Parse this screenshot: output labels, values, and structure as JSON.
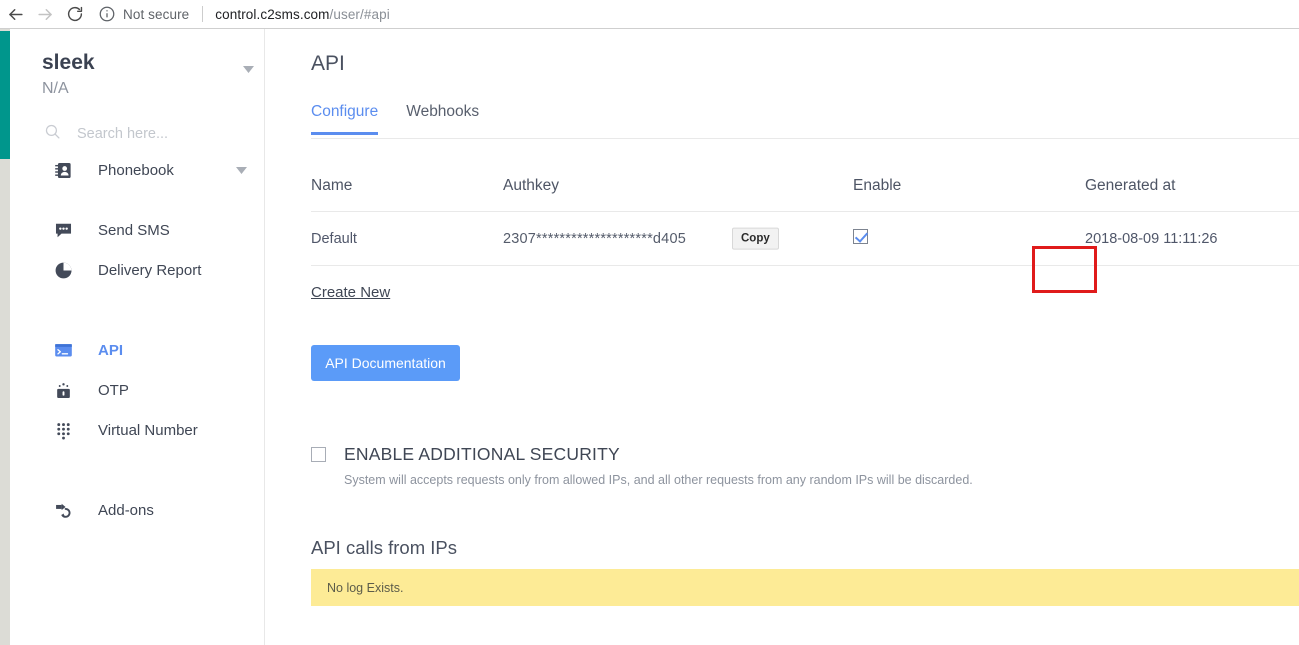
{
  "browser": {
    "back_icon": "back-arrow-icon",
    "forward_icon": "forward-arrow-icon",
    "reload_icon": "reload-icon",
    "security_icon": "info-circle-icon",
    "security_label": "Not secure",
    "url_host": "control.c2sms.com",
    "url_path": "/user/#api"
  },
  "sidebar": {
    "brand": "sleek",
    "brand_sub": "N/A",
    "brand_caret_icon": "chevron-down-icon",
    "search": {
      "placeholder": "Search here...",
      "value": "",
      "icon": "search-icon"
    },
    "items": [
      {
        "label": "Phonebook",
        "icon": "contact-book-icon",
        "active": false,
        "caret": "chevron-down-icon"
      },
      {
        "label": "Send SMS",
        "icon": "chat-bubble-icon",
        "active": false
      },
      {
        "label": "Delivery Report",
        "icon": "pie-chart-icon",
        "active": false
      },
      {
        "label": "API",
        "icon": "terminal-icon",
        "active": true
      },
      {
        "label": "OTP",
        "icon": "lock-icon",
        "active": false
      },
      {
        "label": "Virtual Number",
        "icon": "dialpad-icon",
        "active": false
      },
      {
        "label": "Add-ons",
        "icon": "puzzle-icon",
        "active": false
      }
    ]
  },
  "main": {
    "page_title": "API",
    "tabs": [
      {
        "label": "Configure",
        "active": true
      },
      {
        "label": "Webhooks",
        "active": false
      }
    ],
    "table": {
      "headers": [
        "Name",
        "Authkey",
        "Enable",
        "Generated at"
      ],
      "rows": [
        {
          "name": "Default",
          "authkey": "2307********************d405",
          "copy_label": "Copy",
          "enabled": true,
          "generated_at": "2018-08-09 11:11:26"
        }
      ]
    },
    "create_new_label": "Create New",
    "api_doc_label": "API Documentation",
    "security": {
      "title": "ENABLE ADDITIONAL SECURITY",
      "checked": false,
      "description": "System will accepts requests only from allowed IPs, and all other requests from any random IPs will be discarded."
    },
    "ip_section": {
      "title": "API calls from IPs",
      "banner_text": "No log Exists."
    }
  },
  "colors": {
    "accent_blue": "#5b8def",
    "brand_teal": "#00968c",
    "button_blue": "#5b9bf8",
    "banner_yellow": "#fdeb96",
    "highlight_red": "#e01b1b"
  }
}
